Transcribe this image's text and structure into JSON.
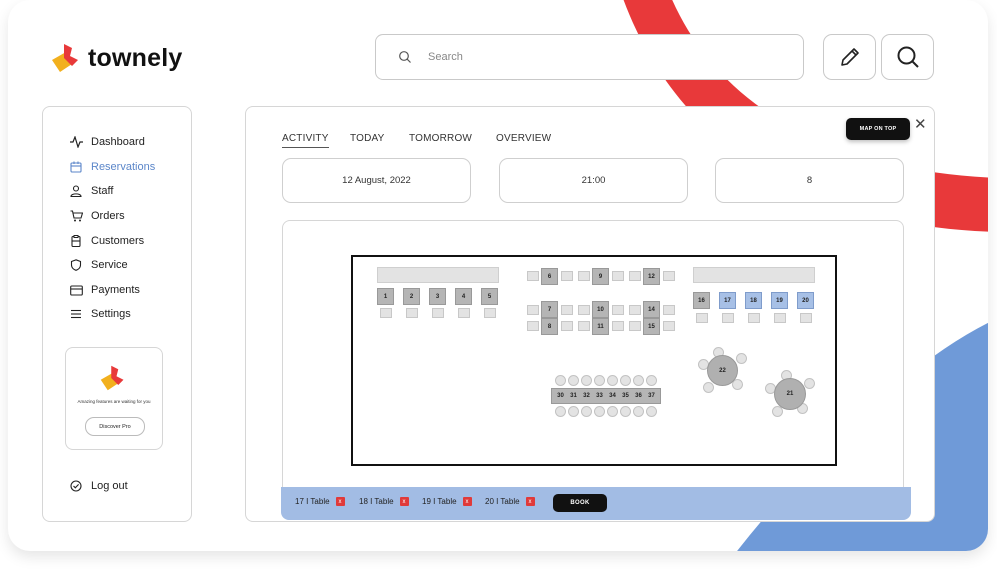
{
  "brand": {
    "name": "townely"
  },
  "search": {
    "placeholder": "Search"
  },
  "header_icons": [
    "pencil-icon",
    "search-icon"
  ],
  "sidebar": {
    "items": [
      {
        "label": "Dashboard",
        "icon": "activity-icon",
        "active": false
      },
      {
        "label": "Reservations",
        "icon": "calendar-icon",
        "active": true
      },
      {
        "label": "Staff",
        "icon": "user-icon",
        "active": false
      },
      {
        "label": "Orders",
        "icon": "cart-icon",
        "active": false
      },
      {
        "label": "Customers",
        "icon": "clipboard-icon",
        "active": false
      },
      {
        "label": "Service",
        "icon": "shield-icon",
        "active": false
      },
      {
        "label": "Payments",
        "icon": "credit-card-icon",
        "active": false
      },
      {
        "label": "Settings",
        "icon": "menu-icon",
        "active": false
      }
    ],
    "promo": {
      "text": "Amazing features are waiting for you",
      "button": "Discover Pro"
    },
    "logout": "Log out"
  },
  "main": {
    "tabs": [
      "ACTIVITY",
      "TODAY",
      "TOMORROW",
      "OVERVIEW"
    ],
    "active_tab": "ACTIVITY",
    "map_on_top": "MAP ON TOP",
    "date": "12 August, 2022",
    "time": "21:00",
    "guests": "8"
  },
  "floor": {
    "row1_tables": [
      "1",
      "2",
      "3",
      "4",
      "5"
    ],
    "middle_tables": [
      "6",
      "9",
      "12",
      "7",
      "10",
      "14",
      "8",
      "11",
      "15"
    ],
    "right_tables": [
      {
        "label": "16",
        "selected": false
      },
      {
        "label": "17",
        "selected": true
      },
      {
        "label": "18",
        "selected": true
      },
      {
        "label": "19",
        "selected": true
      },
      {
        "label": "20",
        "selected": true
      }
    ],
    "long_table": [
      "30",
      "31",
      "32",
      "33",
      "34",
      "35",
      "36",
      "37"
    ],
    "round_tables": [
      "22",
      "21"
    ]
  },
  "selection": {
    "chips": [
      "17 I Table",
      "18 I Table",
      "19 I Table",
      "20 I Table"
    ],
    "remove_mark": "x",
    "book": "BOOK"
  },
  "colors": {
    "accent_red": "#e8393a",
    "accent_blue": "#6f9ad8",
    "selected_table": "#a7c0e6",
    "active_nav": "#5b86c9"
  }
}
